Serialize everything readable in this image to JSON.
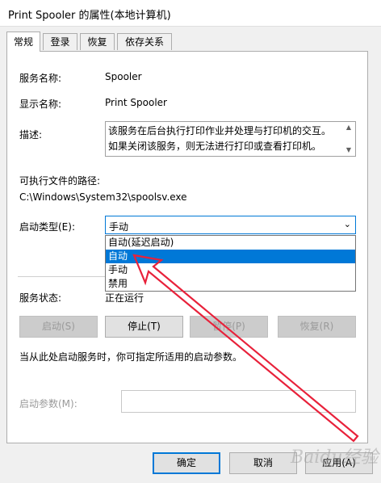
{
  "window": {
    "title": "Print Spooler 的属性(本地计算机)"
  },
  "tabs": [
    {
      "label": "常规",
      "active": true
    },
    {
      "label": "登录",
      "active": false
    },
    {
      "label": "恢复",
      "active": false
    },
    {
      "label": "依存关系",
      "active": false
    }
  ],
  "general": {
    "service_name_label": "服务名称:",
    "service_name_value": "Spooler",
    "display_name_label": "显示名称:",
    "display_name_value": "Print Spooler",
    "description_label": "描述:",
    "description_text": "该服务在后台执行打印作业并处理与打印机的交互。如果关闭该服务，则无法进行打印或查看打印机。",
    "exe_path_label": "可执行文件的路径:",
    "exe_path_value": "C:\\Windows\\System32\\spoolsv.exe",
    "startup_type_label": "启动类型(E):",
    "startup_type_value": "手动",
    "startup_options": [
      "自动(延迟启动)",
      "自动",
      "手动",
      "禁用"
    ],
    "startup_selected_index": 1,
    "service_status_label": "服务状态:",
    "service_status_value": "正在运行",
    "buttons": {
      "start": "启动(S)",
      "stop": "停止(T)",
      "pause": "暂停(P)",
      "resume": "恢复(R)"
    },
    "hint_text": "当从此处启动服务时，你可指定所适用的启动参数。",
    "start_params_label": "启动参数(M):",
    "start_params_value": ""
  },
  "dialog_buttons": {
    "ok": "确定",
    "cancel": "取消",
    "apply": "应用(A)"
  },
  "colors": {
    "accent": "#0078d7",
    "annotation_arrow": "#e8213a"
  },
  "watermark_text": "Baidu经验"
}
